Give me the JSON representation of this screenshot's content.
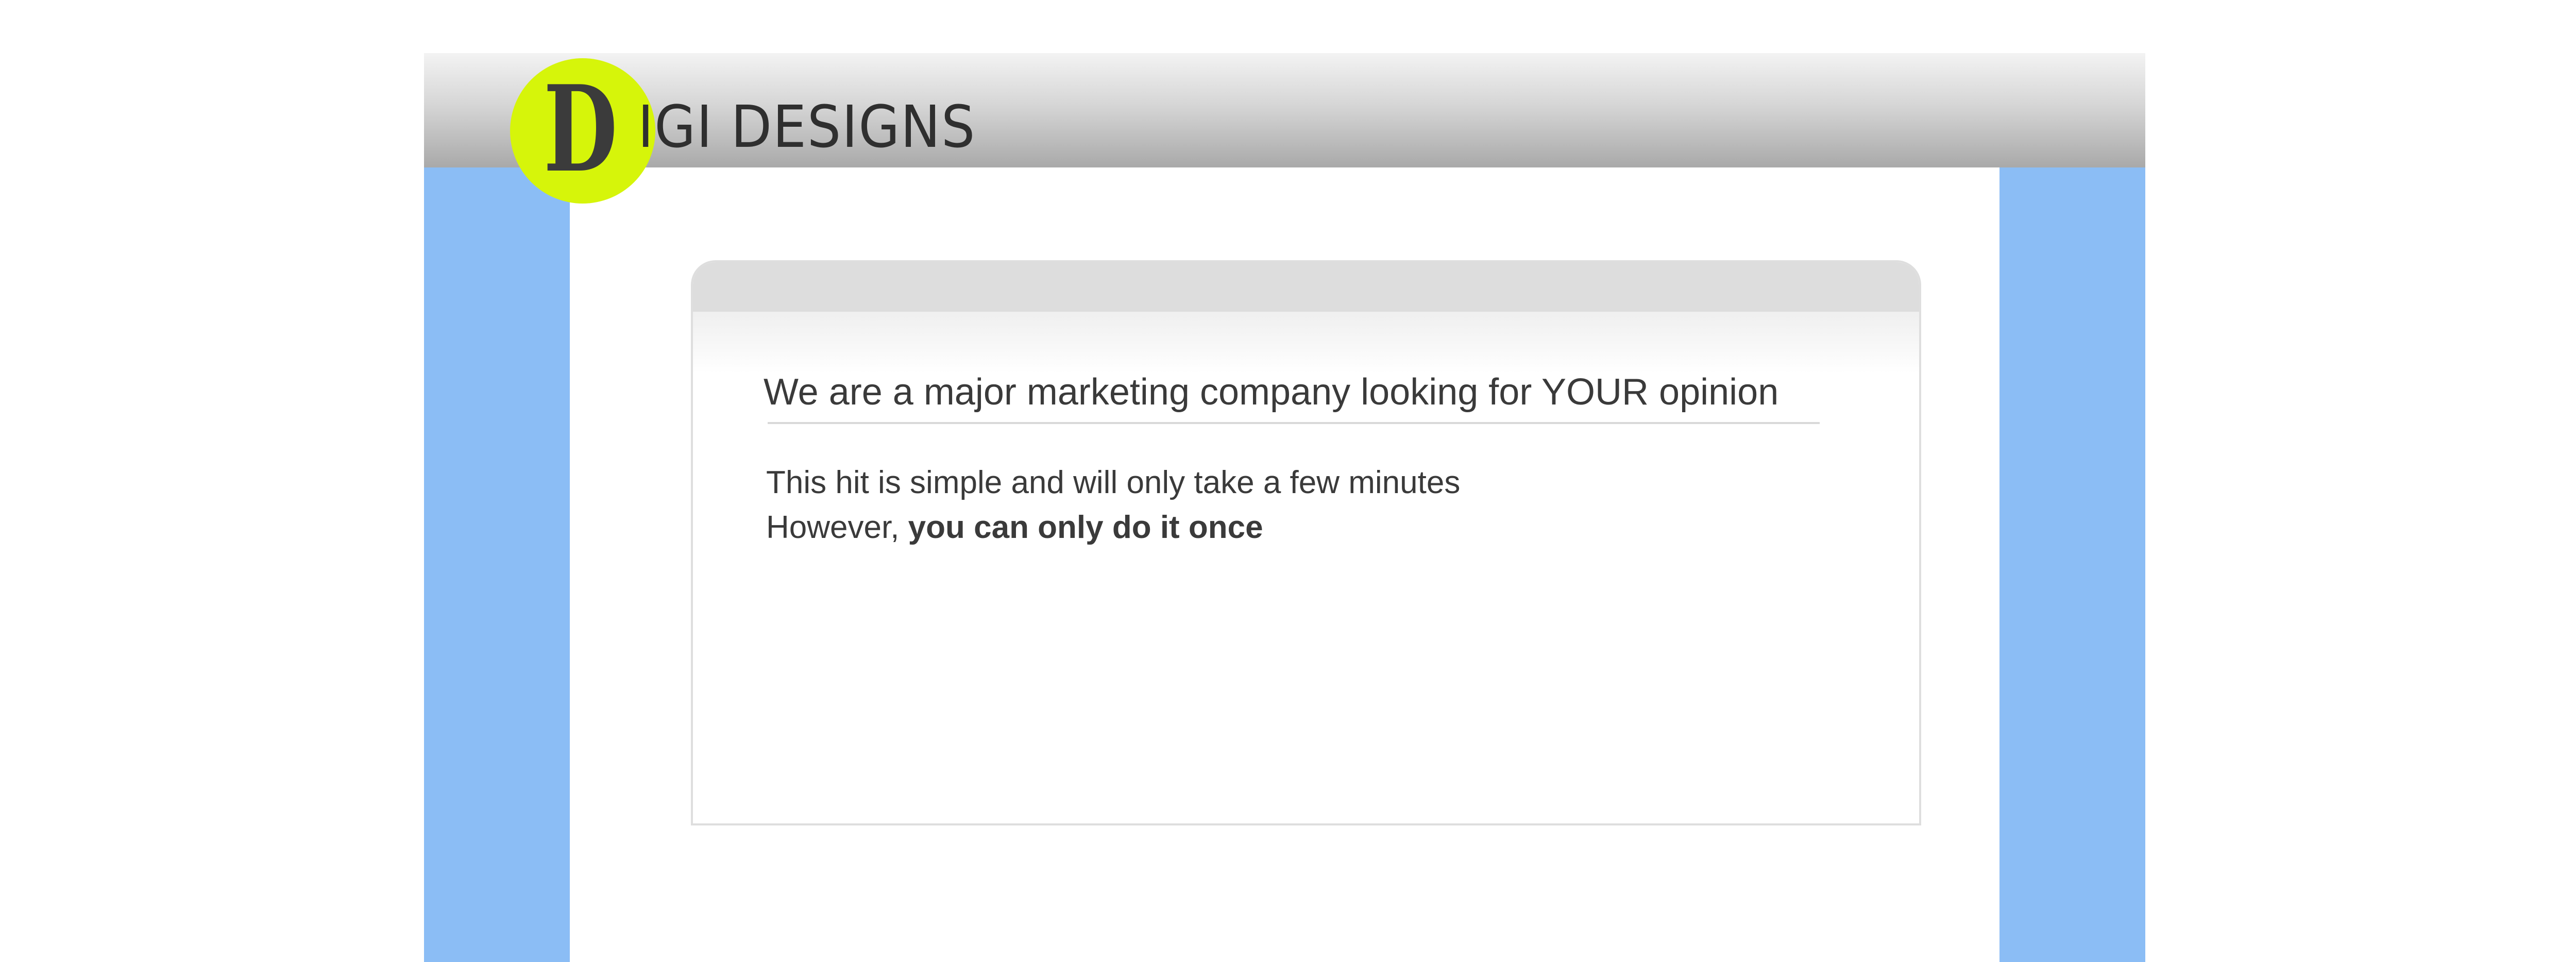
{
  "brand": {
    "logo_letter": "D",
    "logo_rest": "IGI DESIGNS"
  },
  "card": {
    "heading": "We are a major marketing company looking for YOUR opinion",
    "line1": "This hit is simple and will only take a few minutes",
    "line2_prefix": "However, ",
    "line2_bold": "you can only do it once"
  },
  "colors": {
    "side_blue": "#8bbdf5",
    "logo_yellow": "#d6f50a",
    "text_dark": "#3a3a3a"
  }
}
